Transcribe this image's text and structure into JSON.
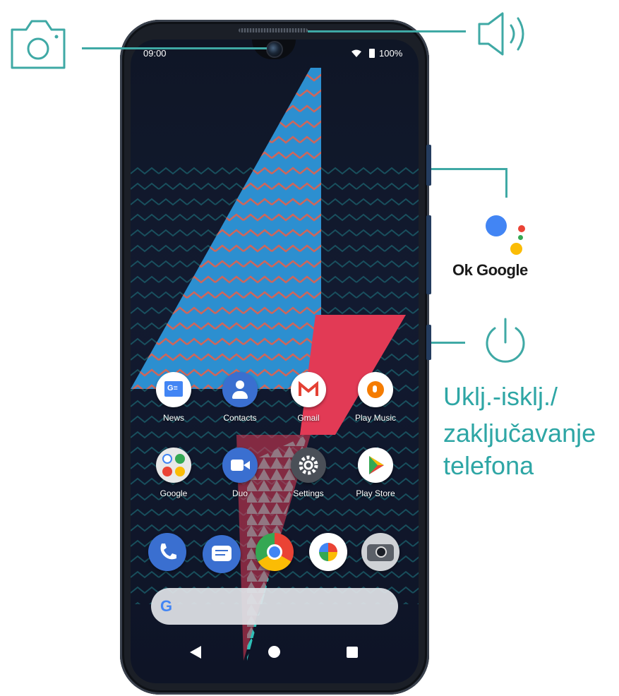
{
  "status_bar": {
    "time": "09:00",
    "battery": "100%"
  },
  "apps": {
    "row1": [
      {
        "label": "News",
        "icon": "google-news-icon"
      },
      {
        "label": "Contacts",
        "icon": "contacts-icon"
      },
      {
        "label": "Gmail",
        "icon": "gmail-icon"
      },
      {
        "label": "Play Music",
        "icon": "play-music-icon"
      }
    ],
    "row2": [
      {
        "label": "Google",
        "icon": "google-folder-icon"
      },
      {
        "label": "Duo",
        "icon": "duo-icon"
      },
      {
        "label": "Settings",
        "icon": "settings-icon"
      },
      {
        "label": "Play Store",
        "icon": "play-store-icon"
      }
    ]
  },
  "dock": [
    "phone-icon",
    "messages-icon",
    "chrome-icon",
    "photos-icon",
    "camera-icon"
  ],
  "search": {
    "logo": "G"
  },
  "callouts": {
    "assistant_label": "Ok Google",
    "power_label_lines": [
      "Uklj.-isklj./",
      "zaključavanje",
      "telefona"
    ]
  },
  "colors": {
    "callout_line": "#3fa9a5",
    "callout_text": "#2ea6a5"
  }
}
